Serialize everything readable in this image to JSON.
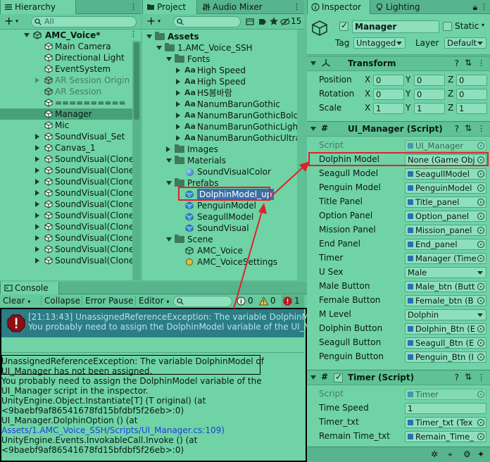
{
  "hierarchy": {
    "tab": "Hierarchy",
    "add_label": "+",
    "search_placeholder": "All",
    "scene": "AMC_Voice*",
    "items": [
      {
        "label": "Main Camera",
        "indent": 1,
        "arrow": "",
        "disabled": false,
        "selected": false
      },
      {
        "label": "Directional Light",
        "indent": 1,
        "arrow": "",
        "disabled": false,
        "selected": false
      },
      {
        "label": "EventSystem",
        "indent": 1,
        "arrow": "",
        "disabled": false,
        "selected": false
      },
      {
        "label": "AR Session Origin",
        "indent": 1,
        "arrow": "right",
        "disabled": true,
        "selected": false
      },
      {
        "label": "AR Session",
        "indent": 1,
        "arrow": "",
        "disabled": true,
        "selected": false
      },
      {
        "label": "==========",
        "indent": 1,
        "arrow": "",
        "disabled": false,
        "selected": false
      },
      {
        "label": "Manager",
        "indent": 1,
        "arrow": "",
        "disabled": false,
        "selected": true
      },
      {
        "label": "Mic",
        "indent": 1,
        "arrow": "",
        "disabled": false,
        "selected": false
      },
      {
        "label": "SoundVisual_Set",
        "indent": 1,
        "arrow": "right",
        "disabled": false,
        "selected": false
      },
      {
        "label": "Canvas_1",
        "indent": 1,
        "arrow": "right",
        "disabled": false,
        "selected": false
      },
      {
        "label": "SoundVisual(Clone",
        "indent": 1,
        "arrow": "right",
        "disabled": false,
        "selected": false
      },
      {
        "label": "SoundVisual(Clone",
        "indent": 1,
        "arrow": "right",
        "disabled": false,
        "selected": false
      },
      {
        "label": "SoundVisual(Clone",
        "indent": 1,
        "arrow": "right",
        "disabled": false,
        "selected": false
      },
      {
        "label": "SoundVisual(Clone",
        "indent": 1,
        "arrow": "right",
        "disabled": false,
        "selected": false
      },
      {
        "label": "SoundVisual(Clone",
        "indent": 1,
        "arrow": "right",
        "disabled": false,
        "selected": false
      },
      {
        "label": "SoundVisual(Clone",
        "indent": 1,
        "arrow": "right",
        "disabled": false,
        "selected": false
      },
      {
        "label": "SoundVisual(Clone",
        "indent": 1,
        "arrow": "right",
        "disabled": false,
        "selected": false
      },
      {
        "label": "SoundVisual(Clone",
        "indent": 1,
        "arrow": "right",
        "disabled": false,
        "selected": false
      },
      {
        "label": "SoundVisual(Clone",
        "indent": 1,
        "arrow": "right",
        "disabled": false,
        "selected": false
      },
      {
        "label": "SoundVisual(Clone",
        "indent": 1,
        "arrow": "right",
        "disabled": false,
        "selected": false
      }
    ]
  },
  "project": {
    "tabs": [
      "Project",
      "Audio Mixer"
    ],
    "add_label": "+",
    "hidden_count": "15",
    "items": [
      {
        "label": "Assets",
        "indent": 0,
        "type": "folder",
        "arrow": "down",
        "bold": true
      },
      {
        "label": "1.AMC_Voice_SSH",
        "indent": 1,
        "type": "folder",
        "arrow": "down",
        "bold": false
      },
      {
        "label": "Fonts",
        "indent": 2,
        "type": "folder",
        "arrow": "down",
        "bold": false
      },
      {
        "label": "High Speed",
        "indent": 3,
        "type": "font",
        "arrow": "right",
        "bold": false
      },
      {
        "label": "High Speed",
        "indent": 3,
        "type": "font",
        "arrow": "right",
        "bold": false
      },
      {
        "label": "HS봄바람",
        "indent": 3,
        "type": "font",
        "arrow": "right",
        "bold": false
      },
      {
        "label": "NanumBarunGothic",
        "indent": 3,
        "type": "font",
        "arrow": "right",
        "bold": false
      },
      {
        "label": "NanumBarunGothicBold",
        "indent": 3,
        "type": "font",
        "arrow": "right",
        "bold": false
      },
      {
        "label": "NanumBarunGothicLight",
        "indent": 3,
        "type": "font",
        "arrow": "right",
        "bold": false
      },
      {
        "label": "NanumBarunGothicUltral",
        "indent": 3,
        "type": "font",
        "arrow": "right",
        "bold": false
      },
      {
        "label": "Images",
        "indent": 2,
        "type": "folder",
        "arrow": "right",
        "bold": false
      },
      {
        "label": "Materials",
        "indent": 2,
        "type": "folder",
        "arrow": "down",
        "bold": false
      },
      {
        "label": "SoundVisualColor",
        "indent": 3,
        "type": "material",
        "arrow": "",
        "bold": false
      },
      {
        "label": "Prefabs",
        "indent": 2,
        "type": "folder",
        "arrow": "down",
        "bold": false
      },
      {
        "label": "DolphinModel_up",
        "indent": 3,
        "type": "prefab",
        "arrow": "",
        "bold": false
      },
      {
        "label": "PenguinModel",
        "indent": 3,
        "type": "prefab",
        "arrow": "",
        "bold": false
      },
      {
        "label": "SeagullModel",
        "indent": 3,
        "type": "prefab",
        "arrow": "",
        "bold": false
      },
      {
        "label": "SoundVisual",
        "indent": 3,
        "type": "prefab",
        "arrow": "",
        "bold": false
      },
      {
        "label": "Scene",
        "indent": 2,
        "type": "folder",
        "arrow": "down",
        "bold": false
      },
      {
        "label": "AMC_Voice",
        "indent": 3,
        "type": "scene",
        "arrow": "",
        "bold": false
      },
      {
        "label": "AMC_VoiceSettings",
        "indent": 3,
        "type": "settings",
        "arrow": "",
        "bold": false
      }
    ]
  },
  "console": {
    "tab": "Console",
    "buttons": [
      "Clear",
      "Collapse",
      "Error Pause",
      "Editor"
    ],
    "counts": {
      "info": "0",
      "warn": "0",
      "error": "1"
    },
    "entry_line1": "[21:13:43] UnassignedReferenceException: The variable DolphinModel of UI_Manager has not been assigned.",
    "entry_line2": "You probably need to assign the DolphinModel variable of the UI_Manager script in the inspector.",
    "detail": [
      "UnassignedReferenceException: The variable DolphinModel of",
      "UI_Manager has not been assigned.",
      "You probably need to assign the DolphinModel variable of the",
      "UI_Manager script in the inspector.",
      "UnityEngine.Object.Instantiate[T] (T original) (at",
      "<9baebf9af86541678fd15bfdbf5f26eb>:0)",
      "UI_Manager.DolphinOption () (at",
      "Assets/1.AMC_Voice_SSH/Scripts/UI_Manager.cs:109)",
      "UnityEngine.Events.InvokableCall.Invoke () (at",
      "<9baebf9af86541678fd15bfdbf5f26eb>:0)"
    ]
  },
  "inspector": {
    "tabs": [
      "Inspector",
      "Lighting"
    ],
    "object_name": "Manager",
    "static_label": "Static",
    "tag_label": "Tag",
    "tag_value": "Untagged",
    "layer_label": "Layer",
    "layer_value": "Default",
    "transform": {
      "title": "Transform",
      "rows": [
        {
          "label": "Position",
          "x": "0",
          "y": "0",
          "z": "0"
        },
        {
          "label": "Rotation",
          "x": "0",
          "y": "0",
          "z": "0"
        },
        {
          "label": "Scale",
          "x": "1",
          "y": "1",
          "z": "1"
        }
      ]
    },
    "ui_manager": {
      "title": "UI_Manager (Script)",
      "rows": [
        {
          "label": "Script",
          "value": "UI_Manager",
          "kind": "obj",
          "grey": true
        },
        {
          "label": "Dolphin Model",
          "value": "None (Game Obj",
          "kind": "none",
          "grey": false
        },
        {
          "label": "Seagull Model",
          "value": "SeagullModel",
          "kind": "obj",
          "grey": false
        },
        {
          "label": "Penguin Model",
          "value": "PenguinModel",
          "kind": "obj",
          "grey": false
        },
        {
          "label": "Title Panel",
          "value": "Title_panel",
          "kind": "obj",
          "grey": false
        },
        {
          "label": "Option Panel",
          "value": "Option_panel",
          "kind": "obj",
          "grey": false
        },
        {
          "label": "Mission Panel",
          "value": "Mission_panel",
          "kind": "obj",
          "grey": false
        },
        {
          "label": "End Panel",
          "value": "End_panel",
          "kind": "obj",
          "grey": false
        },
        {
          "label": "Timer",
          "value": "Manager (Time",
          "kind": "obj",
          "grey": false
        },
        {
          "label": "U Sex",
          "value": "Male",
          "kind": "drop",
          "grey": false
        },
        {
          "label": "Male Button",
          "value": "Male_btn (Butt",
          "kind": "obj",
          "grey": false
        },
        {
          "label": "Female Button",
          "value": "Female_btn (B",
          "kind": "obj",
          "grey": false
        },
        {
          "label": "M Level",
          "value": "Dolphin",
          "kind": "drop",
          "grey": false
        },
        {
          "label": "Dolphin Button",
          "value": "Dolphin_Btn (E",
          "kind": "obj",
          "grey": false
        },
        {
          "label": "Seagull Button",
          "value": "Seagull_Btn (E",
          "kind": "obj",
          "grey": false
        },
        {
          "label": "Penguin Button",
          "value": "Penguin_Btn (I",
          "kind": "obj",
          "grey": false
        }
      ]
    },
    "timer": {
      "title": "Timer (Script)",
      "rows": [
        {
          "label": "Script",
          "value": "Timer",
          "kind": "obj",
          "grey": true
        },
        {
          "label": "Time Speed",
          "value": "1",
          "kind": "text",
          "grey": false
        },
        {
          "label": "Timer_txt",
          "value": "Timer_txt (Tex",
          "kind": "obj",
          "grey": false
        },
        {
          "label": "Remain Time_txt",
          "value": "Remain_Time_",
          "kind": "obj",
          "grey": false
        }
      ]
    }
  }
}
